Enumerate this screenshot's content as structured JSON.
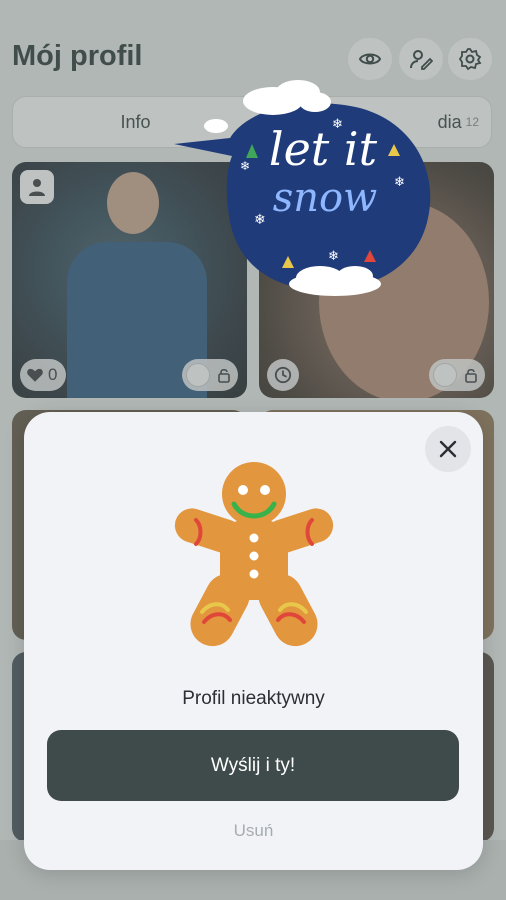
{
  "header": {
    "title": "Mój profil"
  },
  "tabs": {
    "info": "Info",
    "media": "dia",
    "media_count": "12"
  },
  "photos": {
    "likes": "0"
  },
  "badge": {
    "line1": "let it",
    "line2": "snow"
  },
  "modal": {
    "message": "Profil nieaktywny",
    "cta": "Wyślij i ty!",
    "remove": "Usuń"
  },
  "icons": [
    "eye-icon",
    "edit-profile-icon",
    "gear-icon",
    "user-icon",
    "heart-icon",
    "lock-icon",
    "clock-icon",
    "close-icon"
  ]
}
